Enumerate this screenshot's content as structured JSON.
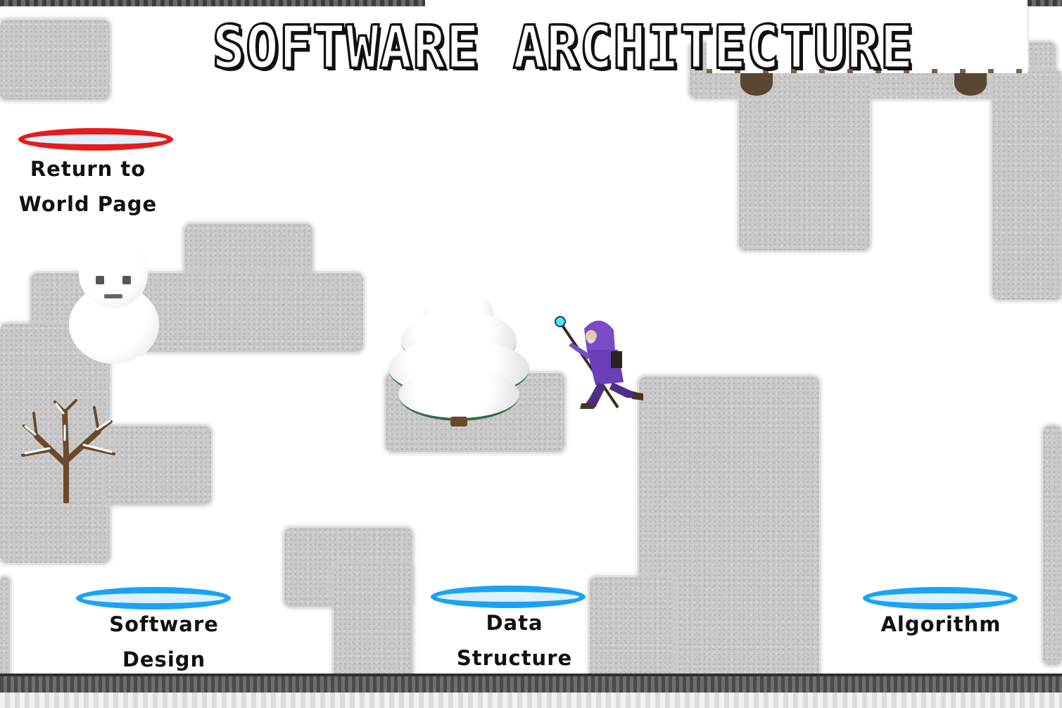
{
  "scene": {
    "title": "SOFTWARE ARCHITECTURE"
  },
  "portals": {
    "return": {
      "line1": "Return to",
      "line2": "World Page",
      "color": "#e61b1b"
    },
    "software_design": {
      "line1": "Software",
      "line2": "Design",
      "color": "#19a3f5"
    },
    "data_structure": {
      "line1": "Data",
      "line2": "Structure",
      "color": "#19a3f5"
    },
    "algorithm": {
      "line1": "Algorithm",
      "color": "#19a3f5"
    }
  },
  "objects": {
    "player": "wizard-character",
    "decorations": [
      "snowman",
      "snowy-pine-tree",
      "bare-snowy-tree",
      "cliff-rocks"
    ]
  }
}
